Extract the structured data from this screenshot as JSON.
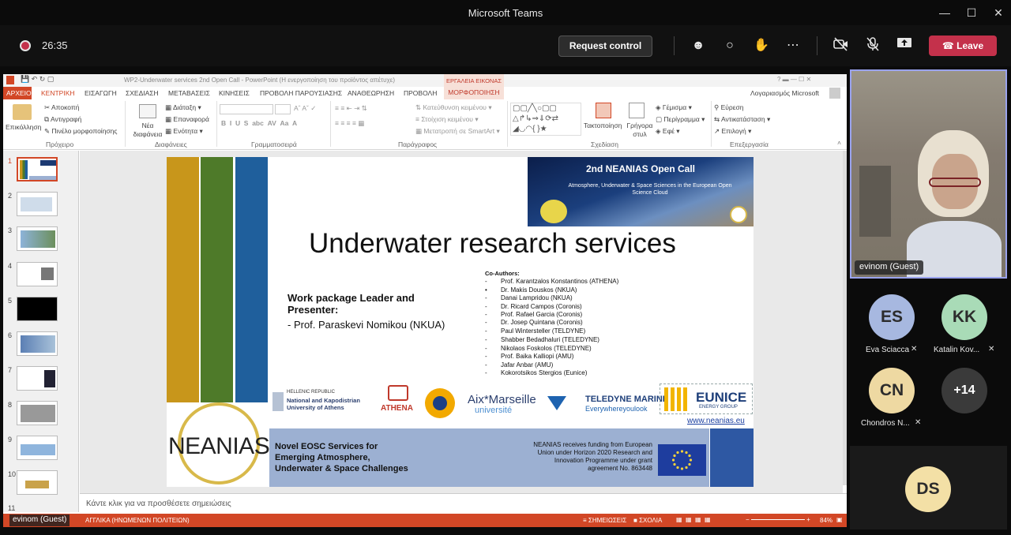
{
  "teams": {
    "window_title": "Microsoft Teams",
    "timer": "26:35",
    "request_control": "Request control",
    "leave": "Leave"
  },
  "ppt": {
    "title": "WP2-Underwater services 2nd Open Call - PowerPoint (Η ενεργοποίηση του προϊόντος απέτυχε)",
    "tools_label": "ΕΡΓΑΛΕΙΑ ΕΙΚΟΝΑΣ",
    "account": "Λογαριασμός Microsoft",
    "tabs": [
      "ΑΡΧΕΙΟ",
      "ΚΕΝΤΡΙΚΗ",
      "ΕΙΣΑΓΩΓΗ",
      "ΣΧΕΔΙΑΣΗ",
      "ΜΕΤΑΒΑΣΕΙΣ",
      "ΚΙΝΗΣΕΙΣ",
      "ΠΡΟΒΟΛΗ ΠΑΡΟΥΣΙΑΣΗΣ",
      "ΑΝΑΘΕΩΡΗΣΗ",
      "ΠΡΟΒΟΛΗ",
      "ΜΟΡΦΟΠΟΙΗΣΗ"
    ],
    "ribbon": {
      "paste": "Επικόλληση",
      "cut": "Αποκοπή",
      "copy": "Αντιγραφή",
      "format_painter": "Πινέλο μορφοποίησης",
      "clipboard": "Πρόχειρο",
      "new_slide": "Νέα\nδιαφάνεια",
      "layout": "Διάταξη",
      "reset": "Επαναφορά",
      "section": "Ενότητα",
      "slides": "Διαφάνειες",
      "font": "Γραμματοσειρά",
      "text_direction": "Κατεύθυνση κειμένου",
      "align_text": "Στοίχιση κειμένου",
      "smartart": "Μετατροπή σε SmartArt",
      "paragraph": "Παράγραφος",
      "arrange": "Τακτοποίηση",
      "quick_styles": "Γρήγορα\nστυλ",
      "fill": "Γέμισμα",
      "outline": "Περίγραμμα",
      "effects": "Εφέ",
      "drawing": "Σχεδίαση",
      "find": "Εύρεση",
      "replace": "Αντικατάσταση",
      "select": "Επιλογή",
      "editing": "Επεξεργασία"
    },
    "notes": "Κάντε κλικ για να προσθέσετε σημειώσεις",
    "status": {
      "user": "evinom (Guest)",
      "language": "ΑΓΓΛΙΚΑ (ΗΝΩΜΕΝΩΝ ΠΟΛΙΤΕΙΩΝ)",
      "notes_btn": "ΣΗΜΕΙΩΣΕΙΣ",
      "comments_btn": "ΣΧΟΛΙΑ",
      "zoom": "84%"
    },
    "thumb_numbers": [
      "1",
      "2",
      "3",
      "4",
      "5",
      "6",
      "7",
      "8",
      "9",
      "10",
      "11"
    ]
  },
  "slide": {
    "title": "Underwater research services",
    "wp_heading": "Work package Leader and Presenter:",
    "presenter": "-    Prof. Paraskevi Nomikou (NKUA)",
    "coauthors_title": "Co-Authors:",
    "coauthors": [
      "Prof. Karantzalos Konstantinos (ATHENA)",
      "Dr. Makis Douskos (NKUA)",
      "Danai Lampridou (NKUA)",
      "Dr. Ricard Campos (Coronis)",
      "Prof. Rafael Garcia (Coronis)",
      "Dr. Josep Quintana (Coronis)",
      "Paul Wintersteller (TELDYNE)",
      "Shabber Bedadhaluri (TELEDYNE)",
      "Nikolaos Foskolos (TELEDYNE)",
      "Prof. Baika Kalliopi (AMU)",
      "Jafar Anbar (AMU)",
      "Kokorotsikos Stergios (Eunice)"
    ],
    "banner_title": "2nd NEANIAS Open Call",
    "banner_sub": "Atmosphere, Underwater & Space Sciences in the European Open Science Cloud",
    "partners": {
      "hellenic": "HELLENIC REPUBLIC",
      "nkua": "National and Kapodistrian University of Athens",
      "athena": "ATHENA",
      "amu1": "Aix*Marseille",
      "amu2": "université",
      "teledyne": "TELEDYNE MARINE",
      "teledyne_sub": "Everywhereyoulook",
      "eunice": "EUNICE",
      "eunice_sub": "ENERGY GROUP"
    },
    "url": "www.neanias.eu",
    "neanias": "NEANIAS",
    "novel": "Novel EOSC Services for Emerging Atmosphere, Underwater & Space Challenges",
    "funding": "NEANIAS receives funding from European Union under Horizon 2020 Research and Innovation Programme under grant agreement No. 863448"
  },
  "participants": {
    "self_name": "evinom (Guest)",
    "people": [
      {
        "initials": "ES",
        "name": "Eva Sciacca",
        "color": "#a7b8e0"
      },
      {
        "initials": "KK",
        "name": "Katalin Kov...",
        "color": "#a9dbb7"
      },
      {
        "initials": "CN",
        "name": "Chondros N...",
        "color": "#eed9a2"
      },
      {
        "initials": "+14",
        "name": "",
        "color": "#3a3a3a"
      },
      {
        "initials": "DS",
        "name": "",
        "color": "#f3e0a6"
      }
    ]
  }
}
